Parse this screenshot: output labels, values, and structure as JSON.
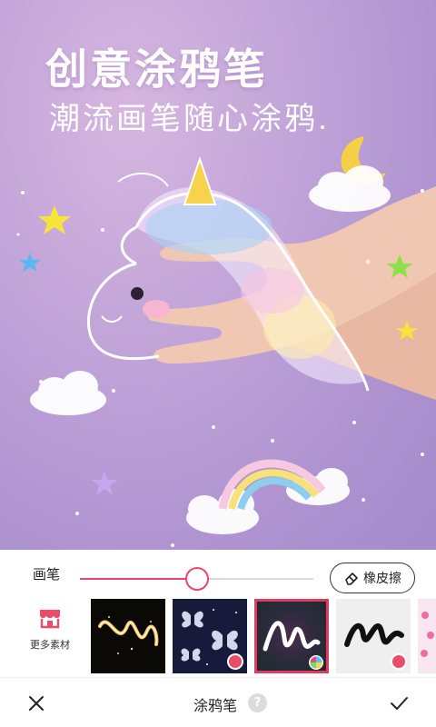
{
  "hero": {
    "title": "创意涂鸦笔",
    "subtitle": "潮流画笔随心涂鸦"
  },
  "brush": {
    "label": "画笔",
    "size_fraction": 0.5,
    "eraser_label": "橡皮擦",
    "accent_color": "#f0436b"
  },
  "materials": {
    "more_label": "更多素材",
    "items": [
      {
        "name": "golden-sparkle-brush",
        "selected": false,
        "download": false
      },
      {
        "name": "butterfly-brush",
        "selected": false,
        "download": true
      },
      {
        "name": "neon-line-brush",
        "selected": true,
        "download": false
      },
      {
        "name": "black-stroke-brush",
        "selected": false,
        "download": true
      },
      {
        "name": "pink-heart-brush",
        "selected": false,
        "download": false
      }
    ]
  },
  "bottom_bar": {
    "title": "涂鸦笔",
    "help": "?"
  },
  "icons": {
    "close": "close-icon",
    "confirm": "check-icon",
    "eraser": "eraser-icon",
    "store": "store-icon",
    "help": "help-icon"
  }
}
